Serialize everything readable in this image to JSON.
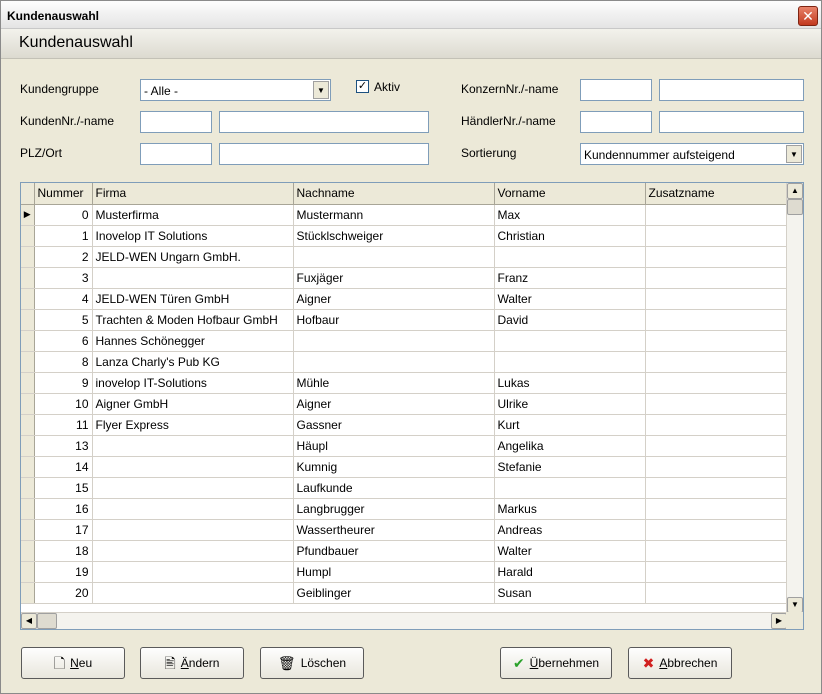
{
  "window": {
    "title": "Kundenauswahl",
    "header": "Kundenauswahl"
  },
  "filters": {
    "kundengruppe_label": "Kundengruppe",
    "kundengruppe_value": "- Alle -",
    "aktiv_label": "Aktiv",
    "aktiv_checked": "✓",
    "kunden_label": "KundenNr./-name",
    "plz_label": "PLZ/Ort",
    "konzern_label": "KonzernNr./-name",
    "haendler_label": "HändlerNr./-name",
    "sortierung_label": "Sortierung",
    "sortierung_value": "Kundennummer aufsteigend"
  },
  "table": {
    "columns": [
      "Nummer",
      "Firma",
      "Nachname",
      "Vorname",
      "Zusatzname"
    ],
    "rows": [
      [
        "0",
        "Musterfirma",
        "Mustermann",
        "Max",
        ""
      ],
      [
        "1",
        "Inovelop IT Solutions",
        "Stücklschweiger",
        "Christian",
        ""
      ],
      [
        "2",
        "JELD-WEN Ungarn GmbH.",
        "",
        "",
        ""
      ],
      [
        "3",
        "",
        "Fuxjäger",
        "Franz",
        ""
      ],
      [
        "4",
        "JELD-WEN Türen GmbH",
        "Aigner",
        "Walter",
        ""
      ],
      [
        "5",
        "Trachten & Moden Hofbaur GmbH",
        "Hofbaur",
        "David",
        ""
      ],
      [
        "6",
        "Hannes Schönegger",
        "",
        "",
        ""
      ],
      [
        "8",
        "Lanza Charly's Pub KG",
        "",
        "",
        ""
      ],
      [
        "9",
        "inovelop IT-Solutions",
        "Mühle",
        "Lukas",
        ""
      ],
      [
        "10",
        "Aigner GmbH",
        "Aigner",
        "Ulrike",
        ""
      ],
      [
        "11",
        "Flyer Express",
        "Gassner",
        "Kurt",
        ""
      ],
      [
        "13",
        "",
        "Häupl",
        "Angelika",
        ""
      ],
      [
        "14",
        "",
        "Kumnig",
        "Stefanie",
        ""
      ],
      [
        "15",
        "",
        "Laufkunde",
        "",
        ""
      ],
      [
        "16",
        "",
        "Langbrugger",
        "Markus",
        ""
      ],
      [
        "17",
        "",
        "Wassertheurer",
        "Andreas",
        ""
      ],
      [
        "18",
        "",
        "Pfundbauer",
        "Walter",
        ""
      ],
      [
        "19",
        "",
        "Humpl",
        "Harald",
        ""
      ],
      [
        "20",
        "",
        "Geiblinger",
        "Susan",
        ""
      ]
    ]
  },
  "buttons": {
    "neu_pre": "",
    "neu_u": "N",
    "neu_post": "eu",
    "aendern_pre": "",
    "aendern_u": "Ä",
    "aendern_post": "ndern",
    "loeschen": "Löschen",
    "uebernehmen_pre": "",
    "uebernehmen_u": "Ü",
    "uebernehmen_post": "bernehmen",
    "abbrechen_pre": "",
    "abbrechen_u": "A",
    "abbrechen_post": "bbrechen"
  },
  "icons": {
    "close": "close-icon",
    "new": "new-document-icon",
    "edit": "edit-document-icon",
    "delete": "trash-icon",
    "accept": "checkmark-icon",
    "cancel": "x-icon"
  },
  "colors": {
    "accept_green": "#2aa12a",
    "cancel_red": "#d12020",
    "close_red": "#c2391f"
  }
}
